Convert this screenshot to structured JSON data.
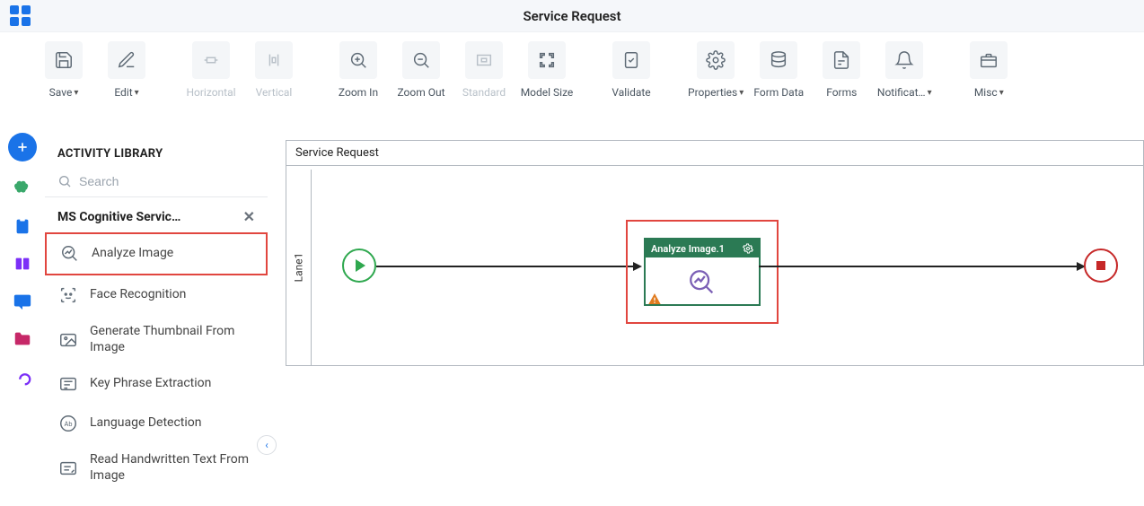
{
  "header": {
    "title": "Service Request"
  },
  "toolbar": {
    "save": "Save",
    "edit": "Edit",
    "horizontal": "Horizontal",
    "vertical": "Vertical",
    "zoom_in": "Zoom In",
    "zoom_out": "Zoom Out",
    "standard": "Standard",
    "model_size": "Model Size",
    "validate": "Validate",
    "properties": "Properties",
    "form_data": "Form Data",
    "forms": "Forms",
    "notifications": "Notificat…",
    "misc": "Misc"
  },
  "sidebar": {
    "title": "ACTIVITY LIBRARY",
    "search_placeholder": "Search",
    "category": "MS Cognitive Servic…",
    "items": [
      "Analyze Image",
      "Face Recognition",
      "Generate Thumbnail From Image",
      "Key Phrase Extraction",
      "Language Detection",
      "Read Handwritten Text From Image"
    ]
  },
  "canvas": {
    "title": "Service Request",
    "lane": "Lane1",
    "node": {
      "title": "Analyze Image.1"
    }
  }
}
